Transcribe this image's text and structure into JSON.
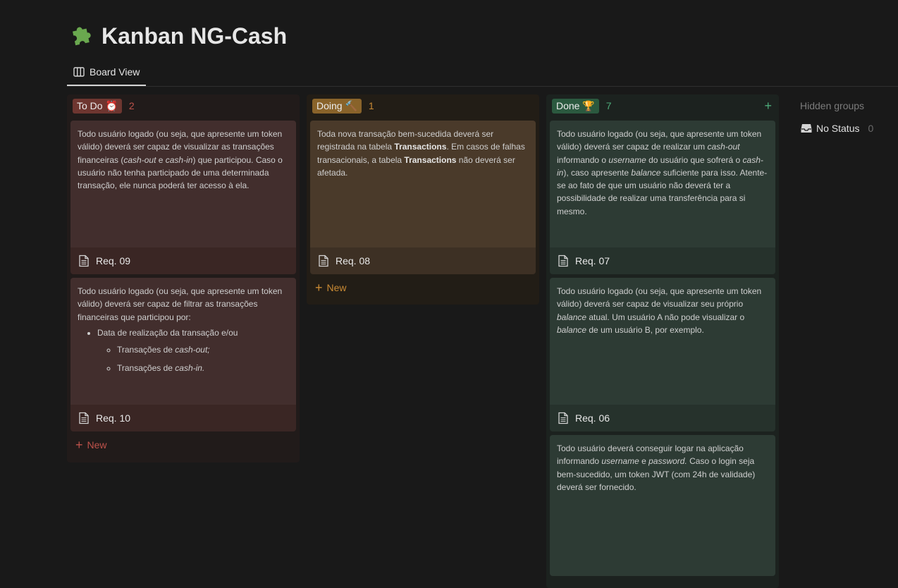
{
  "page": {
    "icon": "puzzle-piece",
    "title": "Kanban NG-Cash"
  },
  "tabs": [
    {
      "label": "Board View",
      "icon": "board-icon",
      "active": true
    }
  ],
  "columns": [
    {
      "label": "To Do ⏰",
      "count": "2",
      "new_label": "New",
      "colors": {
        "column_bg": "#211b1a",
        "pill": "#6e3630",
        "text": "#be524b",
        "card_body": "#422e2d",
        "card_foot": "#3a2624"
      },
      "cards": [
        {
          "body_html": "Todo usuário logado (ou seja, que apresente um token válido) deverá ser capaz de visualizar as transações financeiras (<i>cash-out</i> e <i>cash-in</i>) que participou. Caso o usuário não tenha participado de uma determinada transação, ele nunca poderá ter acesso à ela.",
          "title": "Req. 09"
        },
        {
          "body_html": "Todo usuário logado (ou seja, que apresente um token válido) deverá ser capaz de filtrar as transações financeiras que participou por:<ul><li>Data de realização da transação e/ou<ul><li>Transações de <i>cash-out;</i></li><li>Transações de <i>cash-in.</i></li></ul></li></ul>",
          "title": "Req. 10"
        }
      ]
    },
    {
      "label": "Doing 🔨",
      "count": "1",
      "new_label": "New",
      "colors": {
        "column_bg": "#221d16",
        "pill": "#89632a",
        "text": "#c98a34",
        "card_body": "#4a3a2a",
        "card_foot": "#3d3024"
      },
      "cards": [
        {
          "body_html": "Toda nova transação bem-sucedida deverá ser registrada na tabela <b>Transactions</b>. Em casos de falhas transacionais, a tabela <b>Transactions</b> não deverá ser afetada.",
          "title": "Req. 08"
        }
      ]
    },
    {
      "label": "Done 🏆",
      "count": "7",
      "new_label": "",
      "colors": {
        "column_bg": "#1c221f",
        "pill": "#2b593f",
        "text": "#4dab79",
        "card_body": "#2d3b34",
        "card_foot": "#26322c"
      },
      "cards": [
        {
          "body_html": "Todo usuário logado (ou seja, que apresente um token válido) deverá ser capaz de realizar um <i>cash-out</i> informando o <i>username</i> do usuário que sofrerá o <i>cash-in</i>), caso apresente <i>balance</i> suficiente para isso. Atente-se ao fato de que um usuário não deverá ter a possibilidade de realizar uma transferência para si mesmo.",
          "title": "Req. 07"
        },
        {
          "body_html": "Todo usuário logado (ou seja, que apresente um token válido) deverá ser capaz de visualizar seu próprio <i>balance</i> atual. Um usuário A não pode visualizar o <i>balance</i> de um usuário B, por exemplo.",
          "title": "Req. 06"
        },
        {
          "body_html": "Todo usuário deverá conseguir logar na aplicação informando <i>username</i> e <i>password.</i> Caso o login seja bem-sucedido, um token JWT (com 24h de validade) deverá ser fornecido.",
          "title": ""
        }
      ]
    }
  ],
  "hidden_groups": {
    "title": "Hidden groups",
    "items": [
      {
        "label": "No Status",
        "count": "0",
        "icon": "inbox-icon"
      }
    ]
  }
}
